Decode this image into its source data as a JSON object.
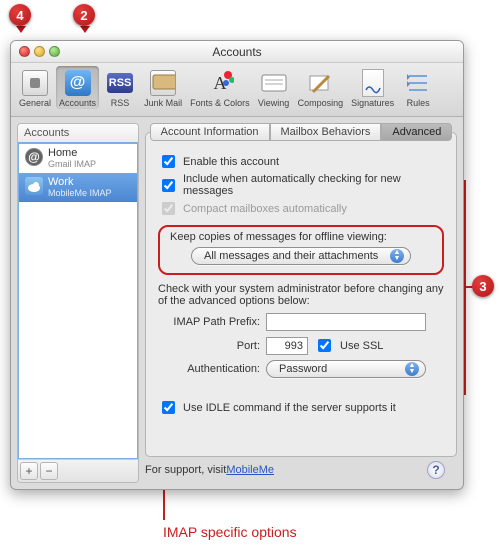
{
  "callouts": {
    "c2": "2",
    "c3": "3",
    "c4": "4"
  },
  "window": {
    "title": "Accounts"
  },
  "toolbar": {
    "general": "General",
    "accounts": "Accounts",
    "rss": "RSS",
    "rss_badge": "RSS",
    "junk": "Junk Mail",
    "fonts": "Fonts & Colors",
    "viewing": "Viewing",
    "composing": "Composing",
    "signatures": "Signatures",
    "rules": "Rules"
  },
  "sidebar": {
    "header": "Accounts",
    "items": [
      {
        "name": "Home",
        "sub": "Gmail IMAP"
      },
      {
        "name": "Work",
        "sub": "MobileMe IMAP"
      }
    ],
    "add": "+",
    "remove": "−"
  },
  "tabs": {
    "info": "Account Information",
    "behaviors": "Mailbox Behaviors",
    "advanced": "Advanced"
  },
  "advanced": {
    "enable": "Enable this account",
    "include": "Include when automatically checking for new messages",
    "compact": "Compact mailboxes automatically",
    "keep_label": "Keep copies of messages for offline viewing:",
    "keep_value": "All messages and their attachments",
    "admin_note": "Check with your system administrator before changing any of the advanced options below:",
    "prefix_label": "IMAP Path Prefix:",
    "prefix_value": "",
    "port_label": "Port:",
    "port_value": "993",
    "ssl": "Use SSL",
    "auth_label": "Authentication:",
    "auth_value": "Password",
    "idle": "Use IDLE command if the server supports it"
  },
  "footer": {
    "prefix": "For support, visit ",
    "link": "MobileMe",
    "help": "?"
  },
  "annotation": "IMAP specific options"
}
